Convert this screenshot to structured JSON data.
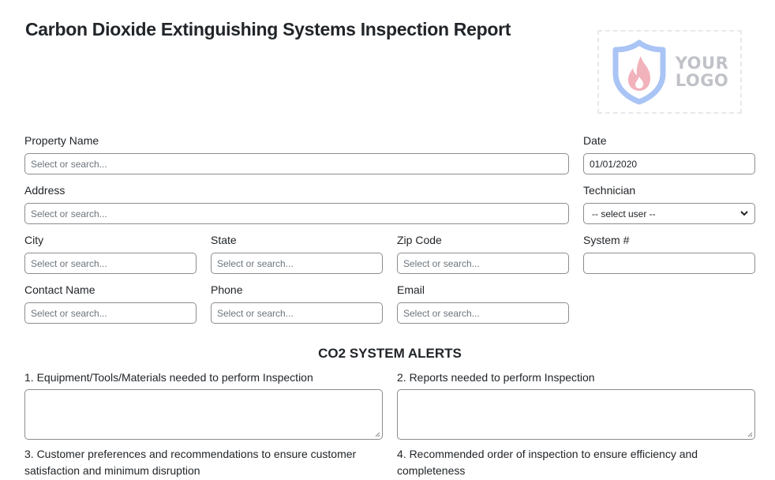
{
  "header": {
    "title": "Carbon Dioxide Extinguishing Systems Inspection Report",
    "logo": {
      "line1": "YOUR",
      "line2": "LOGO",
      "icon": "shield-flame-icon",
      "shield_color": "#a9c4f5",
      "flame_color": "#f2b2bb"
    }
  },
  "form": {
    "property_name": {
      "label": "Property Name",
      "placeholder": "Select or search..."
    },
    "date": {
      "label": "Date",
      "value": "01/01/2020"
    },
    "address": {
      "label": "Address",
      "placeholder": "Select or search..."
    },
    "technician": {
      "label": "Technician",
      "selected": "-- select user --"
    },
    "city": {
      "label": "City",
      "placeholder": "Select or search..."
    },
    "state": {
      "label": "State",
      "placeholder": "Select or search..."
    },
    "zip_code": {
      "label": "Zip Code",
      "placeholder": "Select or search..."
    },
    "system_number": {
      "label": "System #",
      "value": ""
    },
    "contact_name": {
      "label": "Contact Name",
      "placeholder": "Select or search..."
    },
    "phone": {
      "label": "Phone",
      "placeholder": "Select or search..."
    },
    "email": {
      "label": "Email",
      "placeholder": "Select or search..."
    }
  },
  "alerts": {
    "title": "CO2 SYSTEM ALERTS",
    "questions": [
      {
        "label": "1. Equipment/Tools/Materials needed to perform Inspection",
        "value": ""
      },
      {
        "label": "2. Reports needed to perform Inspection",
        "value": ""
      },
      {
        "label": "3. Customer preferences and recommendations to ensure customer satisfaction and minimum disruption"
      },
      {
        "label": "4. Recommended order of inspection to ensure efficiency and completeness"
      }
    ]
  }
}
